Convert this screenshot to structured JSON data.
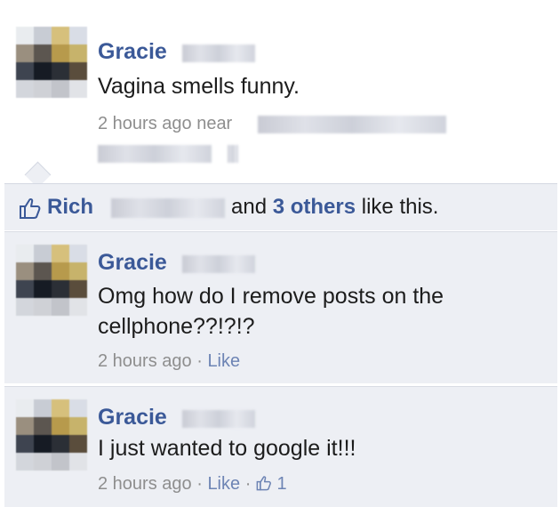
{
  "post": {
    "author": "Gracie",
    "text": "Vagina smells funny.",
    "time": "2 hours ago near"
  },
  "likes": {
    "first_name": "Rich",
    "and_text": "and",
    "others_link": "3 others",
    "suffix": "like this."
  },
  "comments": [
    {
      "author": "Gracie",
      "line1": "Omg how do I remove posts on the",
      "line2": "cellphone??!?!?",
      "time": "2 hours ago",
      "sep": "·",
      "like_label": "Like"
    },
    {
      "author": "Gracie",
      "line1": "I just wanted to google it!!!",
      "time": "2 hours ago",
      "sep": "·",
      "like_label": "Like",
      "sep2": "·",
      "like_count": "1"
    }
  ],
  "icons": {
    "like": "thumbs-up-icon"
  },
  "colors": {
    "link": "#3b5998",
    "ufi_bg": "#edeff4",
    "meta": "#8e8e8e"
  }
}
